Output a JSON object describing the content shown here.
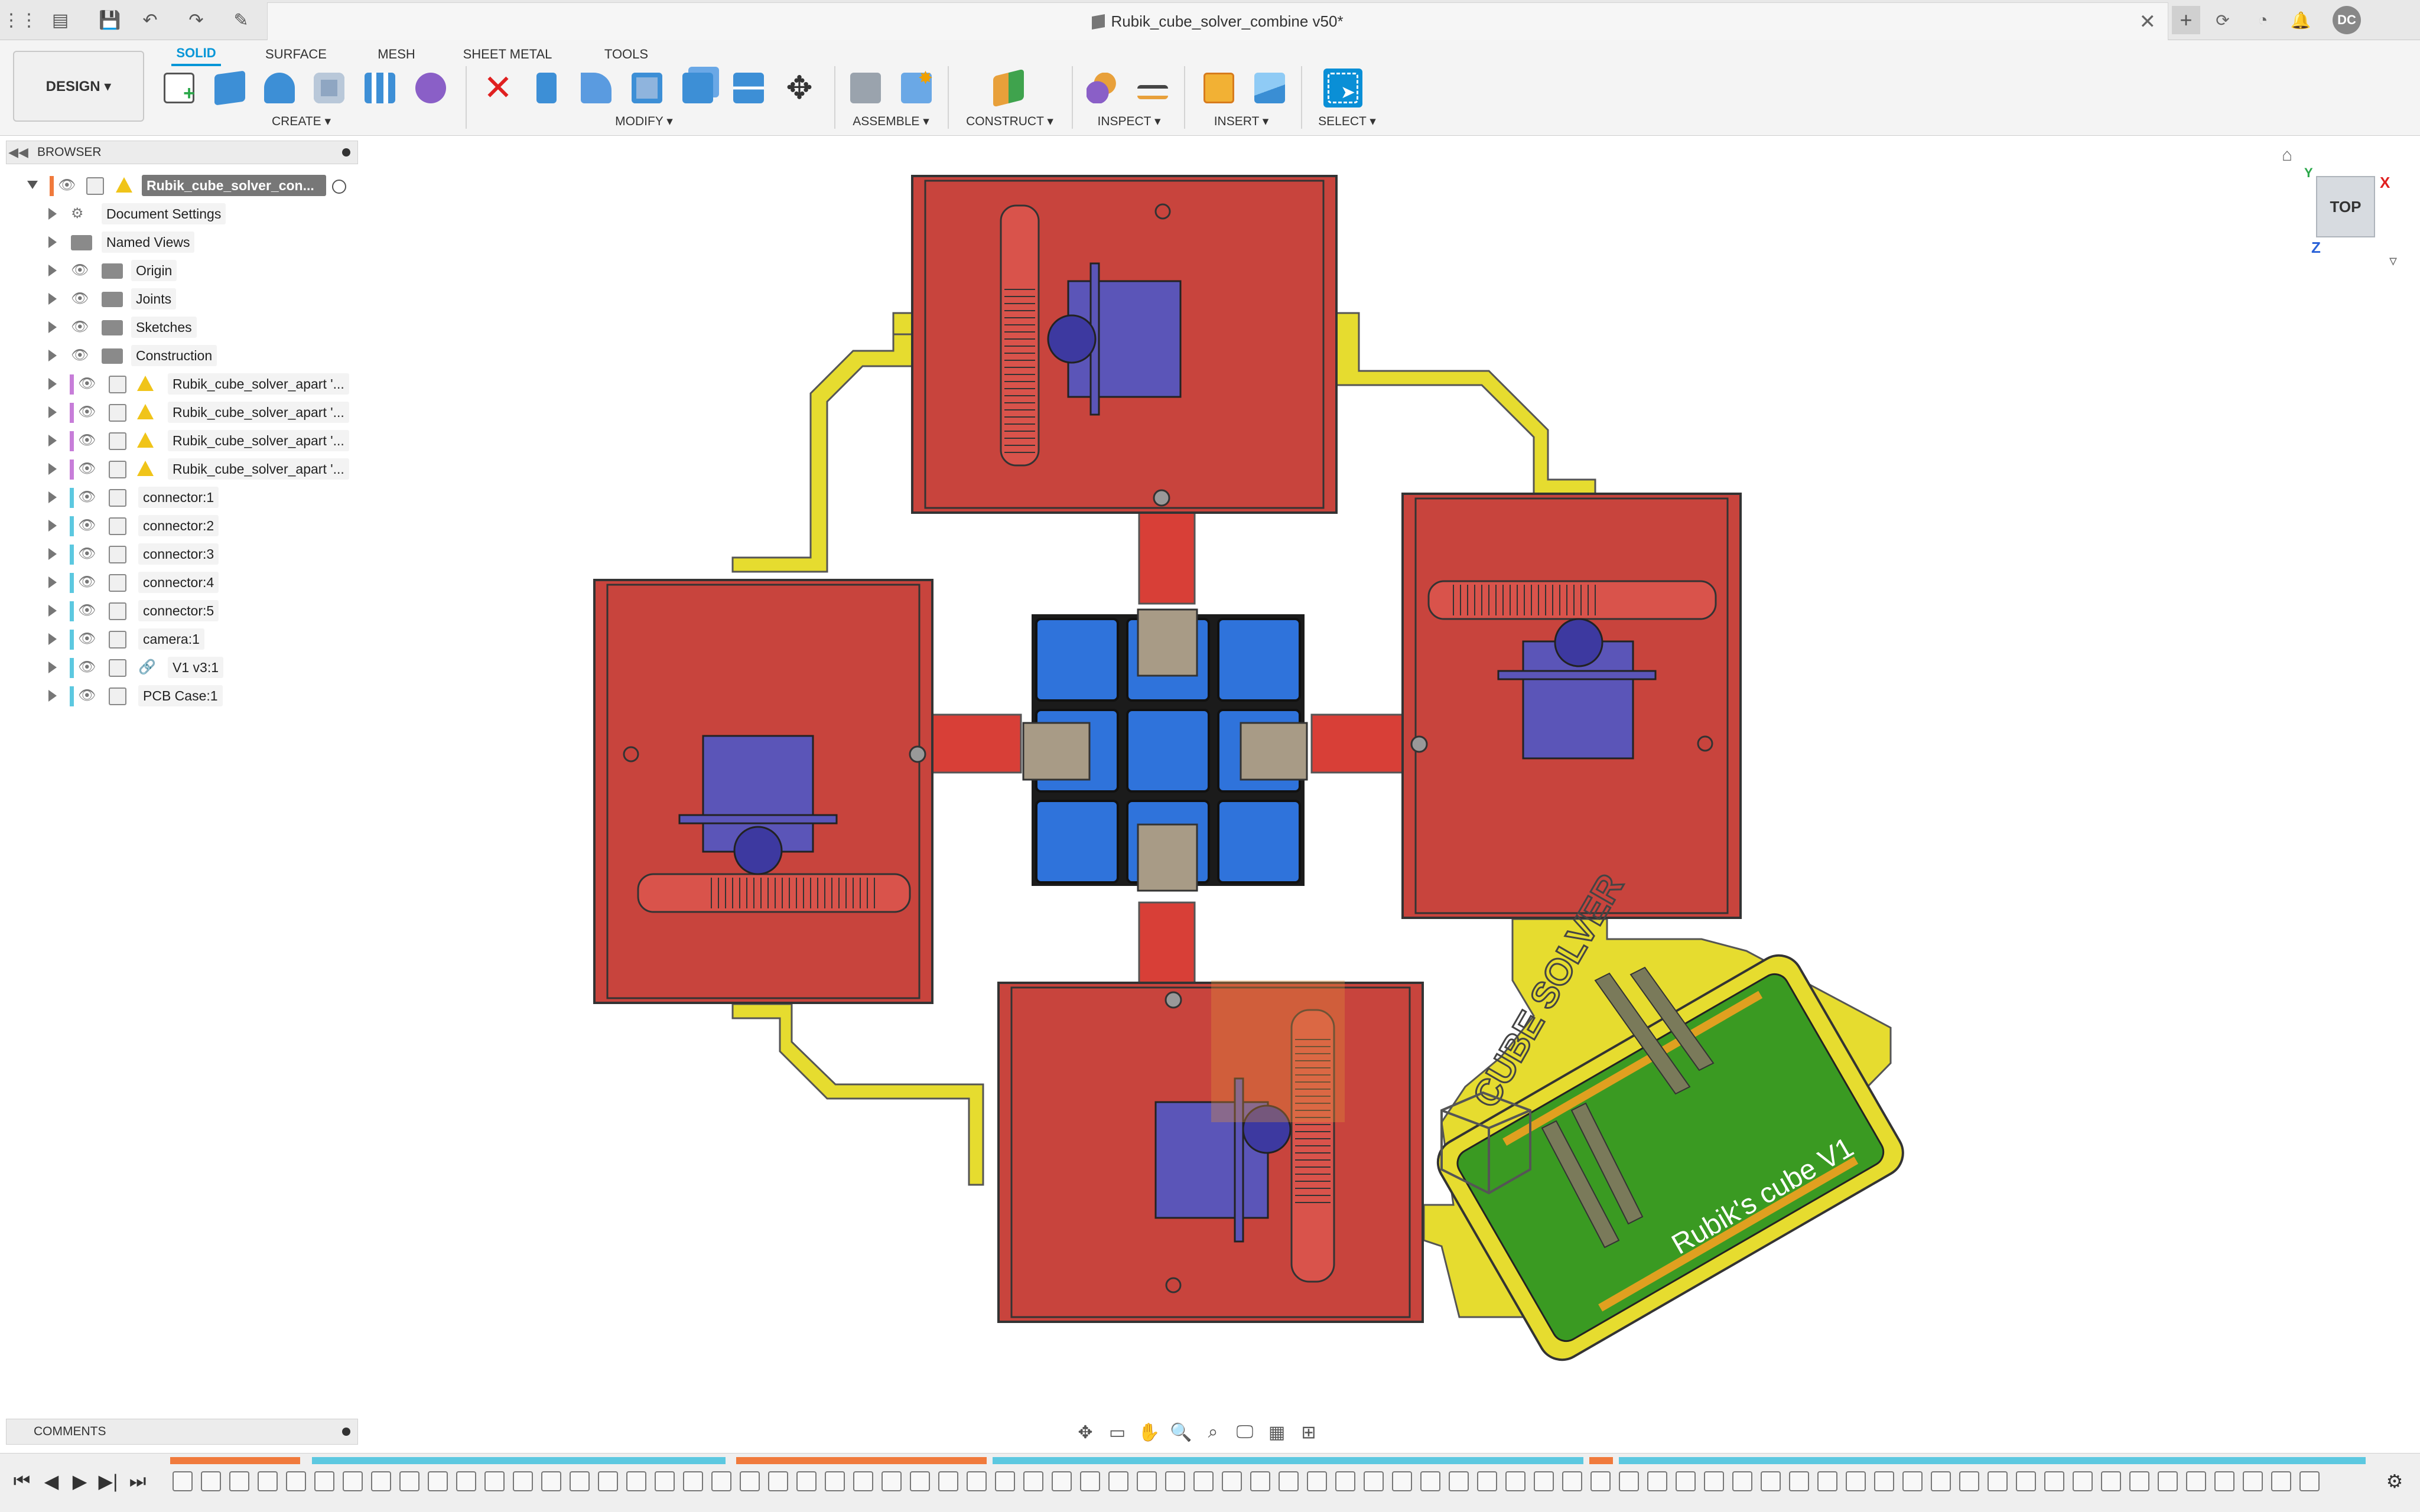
{
  "titlebar": {
    "doc_title": "Rubik_cube_solver_combine v50*",
    "avatar": "DC"
  },
  "ribbon": {
    "workspace": "DESIGN ▾",
    "tabs": [
      "SOLID",
      "SURFACE",
      "MESH",
      "SHEET METAL",
      "TOOLS"
    ],
    "groups": [
      "CREATE ▾",
      "MODIFY ▾",
      "ASSEMBLE ▾",
      "CONSTRUCT ▾",
      "INSPECT ▾",
      "INSERT ▾",
      "SELECT ▾"
    ]
  },
  "browser": {
    "title": "BROWSER",
    "root": "Rubik_cube_solver_con...",
    "items": [
      {
        "label": "Document Settings"
      },
      {
        "label": "Named Views"
      },
      {
        "label": "Origin"
      },
      {
        "label": "Joints"
      },
      {
        "label": "Sketches"
      },
      {
        "label": "Construction"
      },
      {
        "label": "Rubik_cube_solver_apart '..."
      },
      {
        "label": "Rubik_cube_solver_apart '..."
      },
      {
        "label": "Rubik_cube_solver_apart '..."
      },
      {
        "label": "Rubik_cube_solver_apart '..."
      },
      {
        "label": "connector:1"
      },
      {
        "label": "connector:2"
      },
      {
        "label": "connector:3"
      },
      {
        "label": "connector:4"
      },
      {
        "label": "connector:5"
      },
      {
        "label": "camera:1"
      },
      {
        "label": "V1 v3:1"
      },
      {
        "label": "PCB Case:1"
      }
    ]
  },
  "comments": {
    "title": "COMMENTS"
  },
  "viewcube": {
    "face": "TOP",
    "axis_x": "X",
    "axis_y": "Y",
    "axis_z": "Z"
  },
  "model_text": {
    "logo": "CUBE SOLVER",
    "pcb": "Rubik's cube V1"
  },
  "colors": {
    "accent": "#0696d7",
    "housing_red": "#c8443d",
    "bracket_yellow": "#e6dc2f",
    "cube_blue": "#2f73db",
    "servo_purple": "#5b55b8",
    "pcb_green": "#3a9a22"
  }
}
